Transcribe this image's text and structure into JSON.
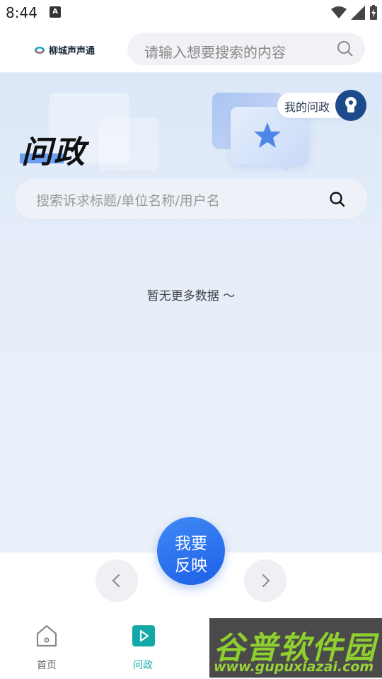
{
  "status_bar": {
    "time": "8:44",
    "notification_badge": "A"
  },
  "header": {
    "app_name": "柳城声声通",
    "search_placeholder": "请输入想要搜索的内容"
  },
  "hero": {
    "title": "问政",
    "my_wenzheng_label": "我的问政",
    "search_placeholder": "搜索诉求标题/单位名称/用户名"
  },
  "content": {
    "empty_text": "暂无更多数据 ～"
  },
  "fab": {
    "line1": "我要",
    "line2": "反映"
  },
  "tabs": [
    {
      "label": "首页",
      "icon": "home-icon",
      "active": false
    },
    {
      "label": "问政",
      "icon": "play-square-icon",
      "active": true
    }
  ],
  "watermark": {
    "brand": "谷普软件园",
    "url": "www.gupuxiazai.com"
  },
  "colors": {
    "accent": "#2a6ff0",
    "active_tab": "#13a8a8",
    "inactive_tab": "#666666"
  }
}
